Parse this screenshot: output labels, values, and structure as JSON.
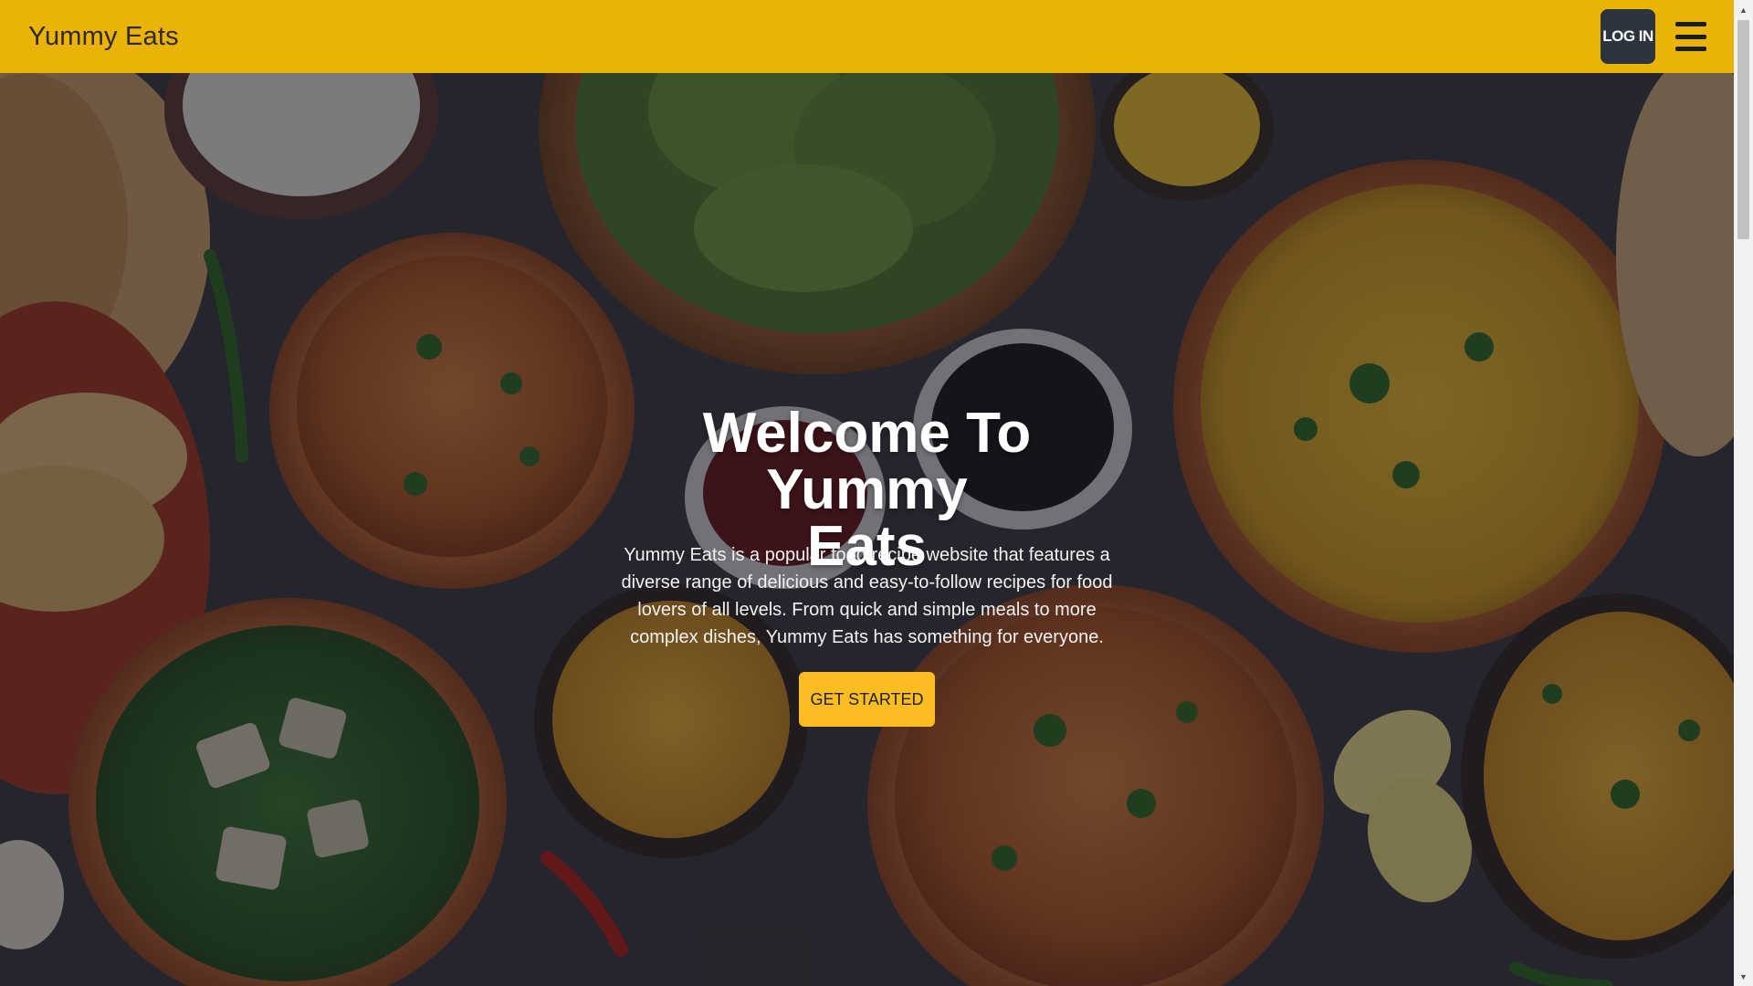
{
  "navbar": {
    "brand": "Yummy Eats",
    "login_label": "LOG IN",
    "menu_icon": "hamburger-menu-icon",
    "background_color": "#e9b308"
  },
  "hero": {
    "title": "Welcome To Yummy Eats",
    "description": "Yummy Eats is a popular food recipe website that features a diverse range of delicious and easy-to-follow recipes for food lovers of all levels. From quick and simple meals to more complex dishes, Yummy Eats has something for everyone.",
    "cta_label": "GET STARTED",
    "cta_color": "#fbbd22",
    "background_image": "food-spread-photo"
  },
  "scrollbar": {
    "up_icon": "scroll-up-arrow-icon",
    "down_icon": "scroll-down-arrow-icon"
  }
}
